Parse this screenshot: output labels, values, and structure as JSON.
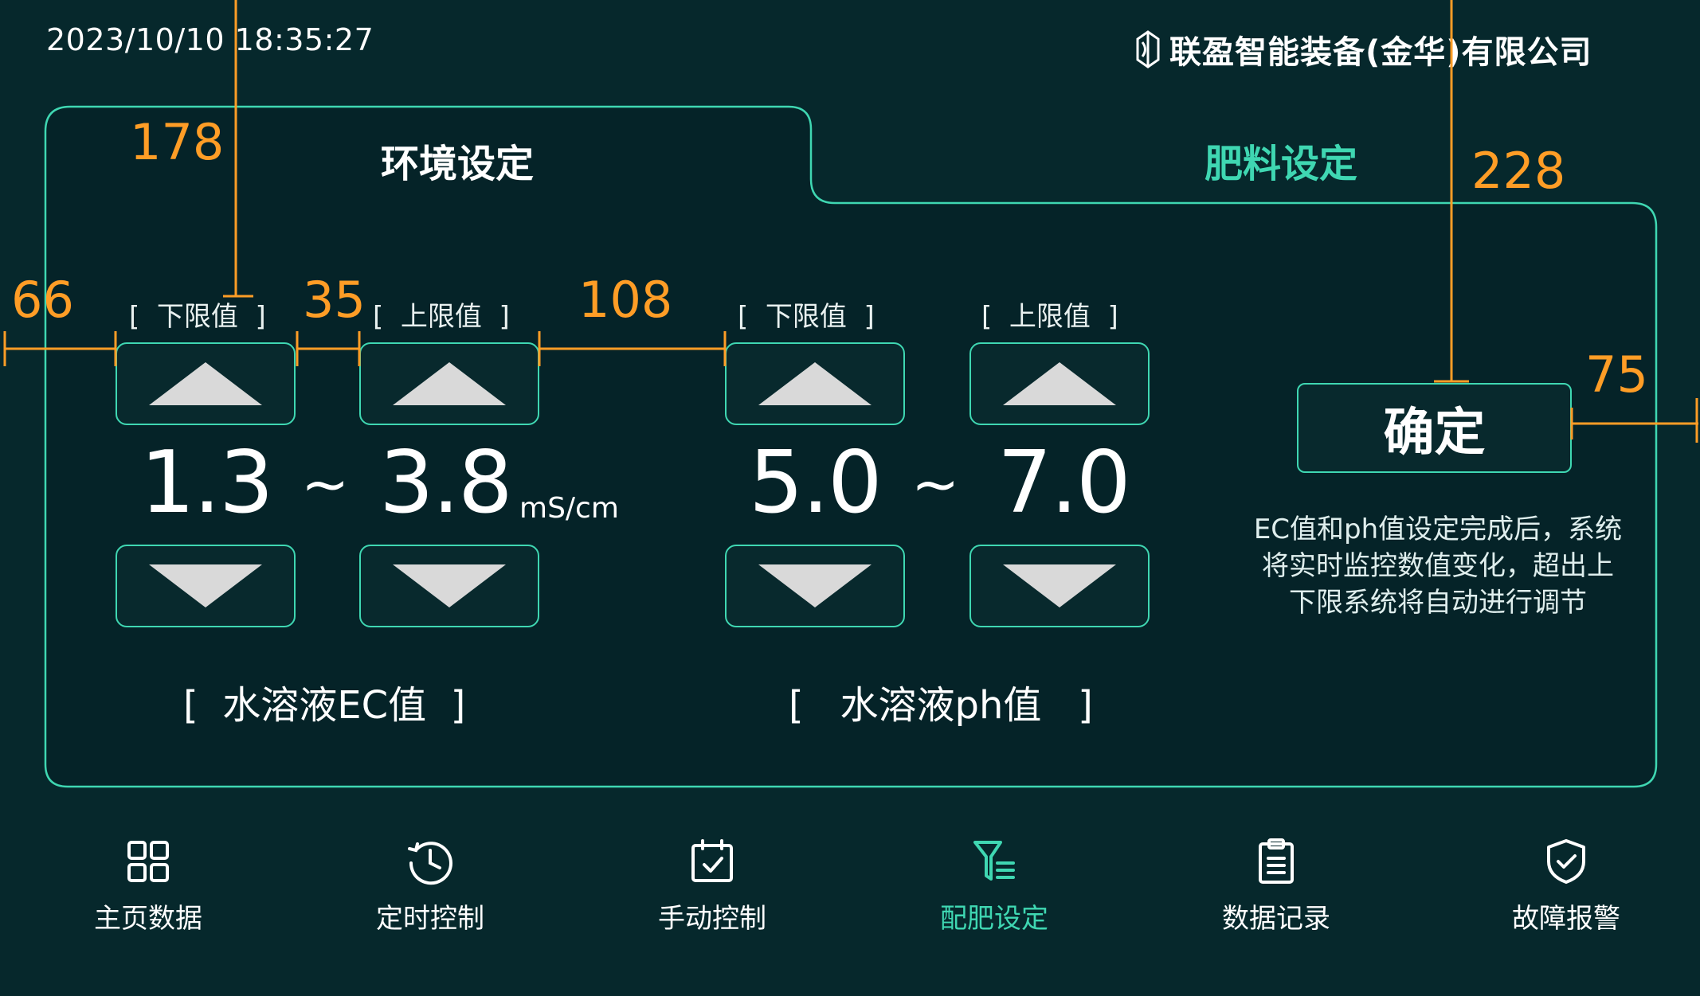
{
  "header": {
    "datetime": "2023/10/10 18:35:27",
    "company": "联盈智能装备(金华)有限公司"
  },
  "tabs": [
    {
      "label": "环境设定",
      "active": true
    },
    {
      "label": "肥料设定",
      "active": false
    }
  ],
  "ec": {
    "lower_label": "[  下限值  ]",
    "upper_label": "[  上限值  ]",
    "lower_value": "1.3",
    "upper_value": "3.8",
    "separator": "~",
    "unit": "mS/cm",
    "title": "[  水溶液EC值  ]"
  },
  "ph": {
    "lower_label": "[  下限值  ]",
    "upper_label": "[  上限值  ]",
    "lower_value": "5.0",
    "upper_value": "7.0",
    "separator": "~",
    "title": "[   水溶液ph值   ]"
  },
  "confirm": {
    "label": "确定",
    "hint": "EC值和ph值设定完成后，系统将实时监控数值变化，超出上下限系统将自动进行调节"
  },
  "nav": [
    {
      "label": "主页数据",
      "icon": "grid-icon",
      "active": false
    },
    {
      "label": "定时控制",
      "icon": "clock-icon",
      "active": false
    },
    {
      "label": "手动控制",
      "icon": "calendar-check-icon",
      "active": false
    },
    {
      "label": "配肥设定",
      "icon": "funnel-list-icon",
      "active": true
    },
    {
      "label": "数据记录",
      "icon": "clipboard-icon",
      "active": false
    },
    {
      "label": "故障报警",
      "icon": "shield-check-icon",
      "active": false
    }
  ],
  "annotations": [
    "178",
    "66",
    "35",
    "108",
    "228",
    "75"
  ],
  "colors": {
    "background": "#06282c",
    "accent": "#3fd7b2",
    "annotation": "#ff9d26"
  }
}
